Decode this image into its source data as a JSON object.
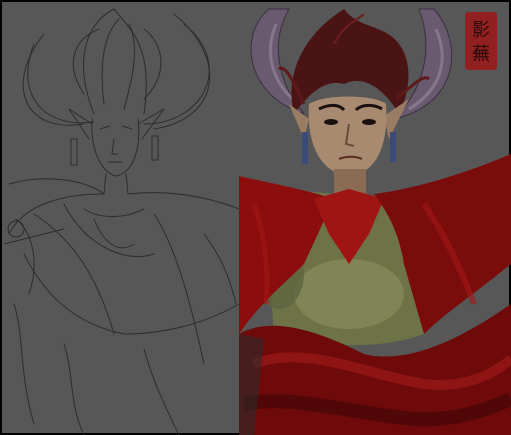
{
  "artwork": {
    "panels": [
      "pencil-sketch",
      "painted-version"
    ],
    "subject": "character-portrait",
    "background_color": "#575757",
    "sketch_line_color": "#2a2a2a",
    "cloak_color": "#8b0d0d",
    "horn_color": "#6a5a70",
    "hair_color": "#4a1414",
    "skin_color": "#a88a70",
    "armor_color": "#6d7247",
    "seal_color": "#9a1b1b",
    "seal_text": "影 蕪"
  }
}
